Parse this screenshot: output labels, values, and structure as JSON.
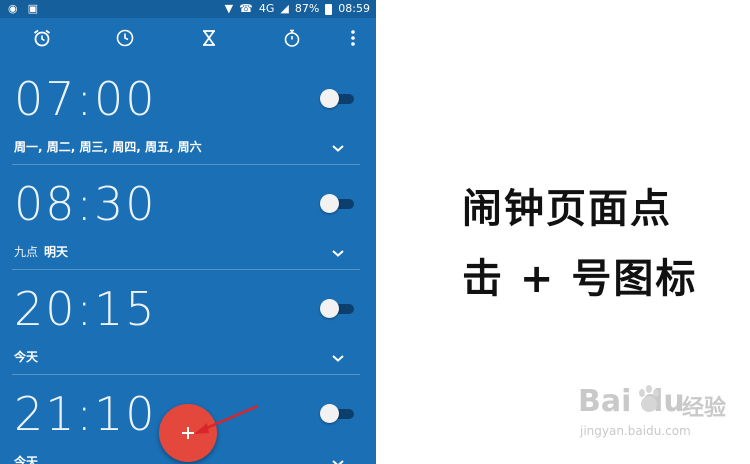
{
  "status_bar": {
    "network": "4G",
    "battery": "87%",
    "clock": "08:59"
  },
  "toolbar": {
    "icons": [
      "alarm-icon",
      "clock-icon",
      "timer-icon",
      "stopwatch-icon",
      "more-vert-icon"
    ]
  },
  "alarms": [
    {
      "time": "07:00",
      "muted": "",
      "label": "周一, 周二, 周三, 周四, 周五, 周六",
      "enabled": false
    },
    {
      "time": "08:30",
      "muted": "九点",
      "label": "明天",
      "enabled": false
    },
    {
      "time": "20:15",
      "muted": "",
      "label": "今天",
      "enabled": false
    },
    {
      "time": "21:10",
      "muted": "",
      "label": "今天",
      "enabled": false
    }
  ],
  "fab": {
    "symbol": "+"
  },
  "caption": {
    "line1": "闹钟页面点",
    "line2": "击 + 号图标"
  },
  "watermark": {
    "brand": "Bai  du",
    "brand_suffix": "经验",
    "url": "jingyan.baidu.com"
  },
  "colors": {
    "app_blue": "#1a6fb5",
    "fab_red": "#e4473b",
    "arrow_red": "#d8262a"
  }
}
